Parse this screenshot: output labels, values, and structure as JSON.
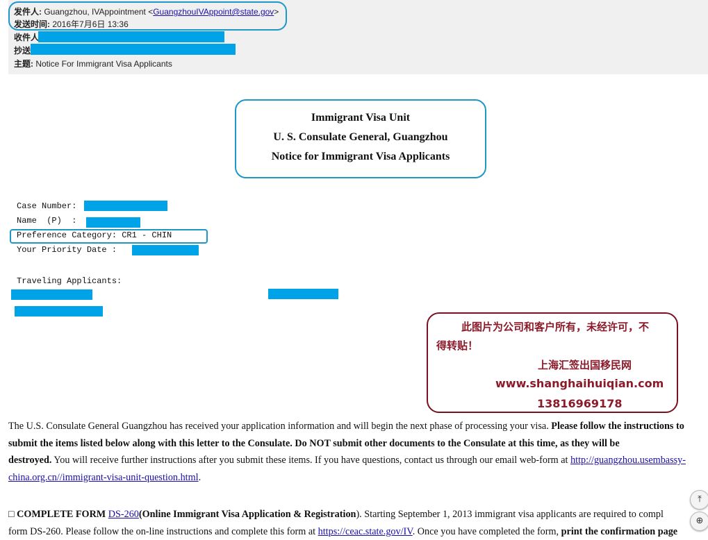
{
  "email": {
    "from_label": "发件人:",
    "from_name": " Guangzhou, IVAppointment <",
    "from_email": "GuangzhouIVAppoint@state.gov",
    "from_close": ">",
    "sent_label": "发送时间:",
    "sent_value": " 2016年7月6日 13:36",
    "to_label": "收件人",
    "cc_label": "抄送",
    "subject_label": "主题:",
    "subject_value": " Notice For Immigrant Visa Applicants"
  },
  "title": {
    "line1": "Immigrant Visa Unit",
    "line2": "U. S. Consulate General, Guangzhou",
    "line3": "Notice for Immigrant Visa Applicants"
  },
  "case": {
    "case_number_label": "Case Number:",
    "name_label": "Name  (P)  :",
    "preference_label": "Preference Category: CR1 - CHIN",
    "priority_label": "Your Priority Date :",
    "traveling_label": "Traveling Applicants:"
  },
  "watermark": {
    "line1": "此图片为公司和客户所有，未经许可，不",
    "line2": "得转贴！",
    "company": "上海汇签出国移民网",
    "website": "www.shanghaihuiqian.com",
    "phone": "13816969178"
  },
  "body": {
    "p1_l1_a": "The U.S. Consulate General Guangzhou has received your application information and will begin the next phase of processing your visa.  ",
    "p1_l1_b": "Please follow the instructions to",
    "p1_l2": "submit the items listed below along with this letter to the Consulate. Do NOT submit other documents to the Consulate at this time, as they will be",
    "p1_l3_a": "destroyed.",
    "p1_l3_b": " You will receive further instructions after you submit these items. If you have questions, contact us through our email web-form at ",
    "p1_link_a": "http://guangzhou.usembassy-",
    "p1_link_b": "china.org.cn//immigrant-visa-unit-question.html",
    "p1_l4_end": ".",
    "p2_box": "□ ",
    "p2_head": "COMPLETE FORM ",
    "p2_ds": "DS-260",
    "p2_paren": "(Online Immigrant Visa Application & Registration",
    "p2_l1_rest": "). Starting September 1, 2013 immigrant visa applicants are required to compl",
    "p2_l2_a": "form DS-260. Please follow the on-line instructions and complete this form at ",
    "p2_link": "https://ceac.state.gov/IV",
    "p2_l2_b": ". Once you have completed the form, ",
    "p2_l2_c": "print the confirmation page"
  },
  "controls": {
    "scroll_top_glyph": "⤒",
    "zoom_glyph": "⊕"
  }
}
